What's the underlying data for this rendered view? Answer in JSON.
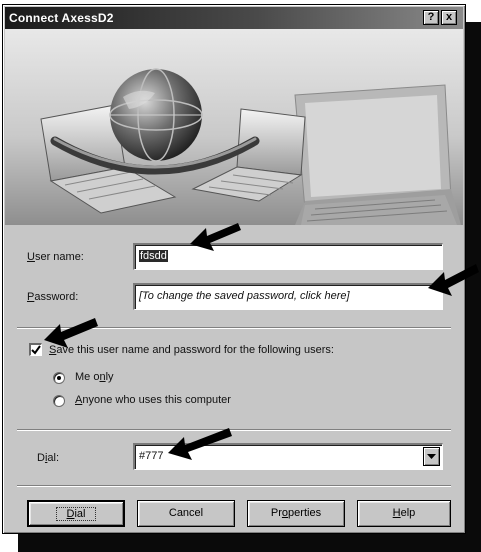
{
  "window": {
    "title": "Connect AxessD2",
    "help_button": "?",
    "close_button": "x"
  },
  "form": {
    "username_label_key": "U",
    "username_label_rest": "ser name:",
    "username_value": "fdsdd",
    "password_label_key": "P",
    "password_label_rest": "assword:",
    "password_hint": "[To change the saved password, click here]",
    "save_label_key": "S",
    "save_label_rest": "ave this user name and password for the following users:",
    "save_checked": true,
    "radio_me_prefix": "Me o",
    "radio_me_key": "n",
    "radio_me_rest": "ly",
    "radio_anyone_key": "A",
    "radio_anyone_rest": "nyone who uses this computer",
    "selected_radio": "me-only",
    "dial_label_prefix": "D",
    "dial_label_key": "i",
    "dial_label_rest": "al:",
    "dial_value": "#777"
  },
  "buttons": {
    "dial_key": "D",
    "dial_rest": "ial",
    "cancel": "Cancel",
    "properties_prefix": "Pr",
    "properties_key": "o",
    "properties_rest": "perties",
    "help_key": "H",
    "help_rest": "elp"
  },
  "icons": [
    "globe-icon",
    "laptop-icon",
    "keyboard-icon",
    "annotation-arrow-icon",
    "dropdown-arrow-icon",
    "checkmark-icon"
  ],
  "colors": {
    "dialog_face": "#c6c6c6",
    "title_start": "#1a1a1a",
    "title_end": "#8a8a8a",
    "selection": "#2a2a2a"
  }
}
